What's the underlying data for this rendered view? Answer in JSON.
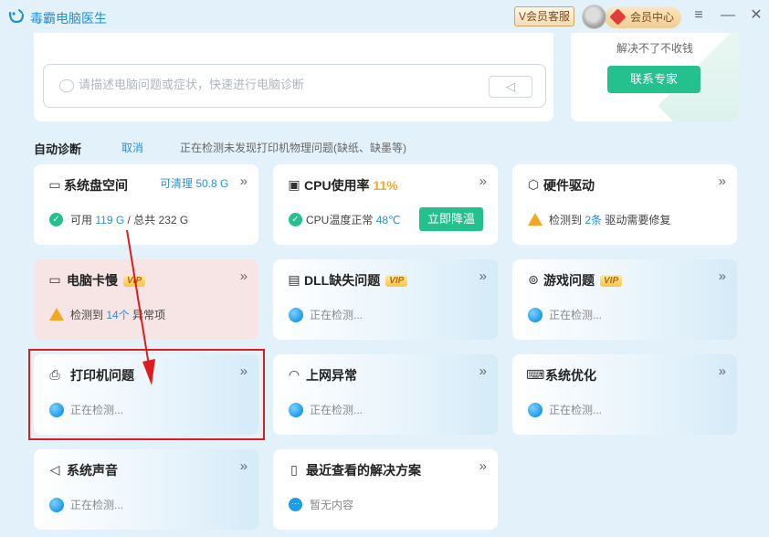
{
  "titlebar": {
    "app_title": "毒霸电脑医生",
    "vip_service": "V会员客服",
    "member_center": "会员中心",
    "menu_icon": "≡",
    "minimize_icon": "—",
    "close_icon": "✕"
  },
  "search": {
    "placeholder": "请描述电脑问题或症状，快速进行电脑诊断",
    "send_icon": "◁"
  },
  "expert": {
    "text": "解决不了不收钱",
    "button": "联系专家"
  },
  "diagnosis": {
    "label": "自动诊断",
    "cancel": "取消",
    "status": "正在检测未发现打印机物理问题(缺纸、缺墨等)"
  },
  "cards": {
    "disk": {
      "title": "系统盘空间",
      "free_label": "可清理 50.8 G",
      "available_label": "可用",
      "available": "119 G",
      "total_label": "/ 总共 232 G"
    },
    "cpu": {
      "title": "CPU使用率",
      "usage": "11%",
      "temp_label": "CPU温度正常",
      "temp": "48℃",
      "button": "立即降温"
    },
    "driver": {
      "title": "硬件驱动",
      "prefix": "检测到",
      "count": "2条",
      "suffix": "驱动需要修复"
    },
    "lag": {
      "title": "电脑卡慢",
      "vip": "VIP",
      "prefix": "检测到",
      "count": "14个",
      "suffix": "异常项"
    },
    "dll": {
      "title": "DLL缺失问题",
      "vip": "VIP",
      "status": "正在检测..."
    },
    "game": {
      "title": "游戏问题",
      "vip": "VIP",
      "status": "正在检测..."
    },
    "printer": {
      "title": "打印机问题",
      "status": "正在检测..."
    },
    "network": {
      "title": "上网异常",
      "status": "正在检测..."
    },
    "optimize": {
      "title": "系统优化",
      "status": "正在检测..."
    },
    "sound": {
      "title": "系统声音",
      "status": "正在检测..."
    },
    "recent": {
      "title": "最近查看的解决方案",
      "status": "暂无内容"
    }
  },
  "more_icon": "»",
  "colors": {
    "accent": "#1e8fd8",
    "green": "#24c08e",
    "warn": "#f5a623",
    "highlight": "#e01b1b"
  }
}
